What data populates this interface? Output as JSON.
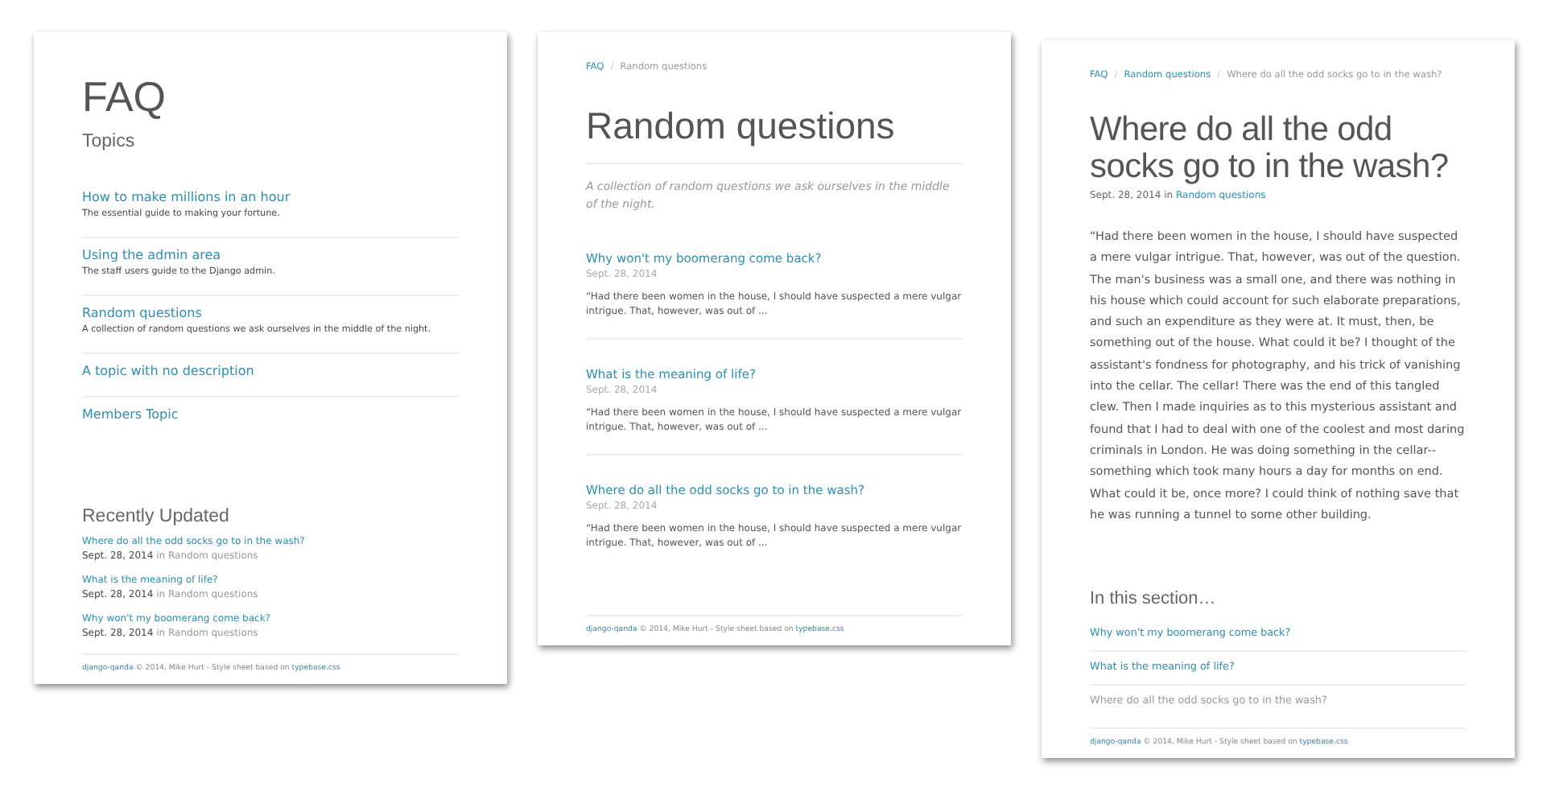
{
  "pages": [
    {
      "kind": "index",
      "title": "FAQ",
      "subtitle": "Topics",
      "topics": [
        {
          "title": "How to make millions in an hour",
          "description": "The essential guide to making your fortune."
        },
        {
          "title": "Using the admin area",
          "description": "The staff users guide to the Django admin."
        },
        {
          "title": "Random questions",
          "description": "A collection of random questions we ask ourselves in the middle of the night."
        },
        {
          "title": "A topic with no description"
        },
        {
          "title": "Members Topic"
        }
      ],
      "recent_heading": "Recently Updated",
      "recent": [
        {
          "title": "Where do all the odd socks go to in the wash?",
          "date": "Sept. 28, 2014",
          "in_label": "in",
          "category": "Random questions"
        },
        {
          "title": "What is the meaning of life?",
          "date": "Sept. 28, 2014",
          "in_label": "in",
          "category": "Random questions"
        },
        {
          "title": "Why won't my boomerang come back?",
          "date": "Sept. 28, 2014",
          "in_label": "in",
          "category": "Random questions"
        }
      ],
      "footer": {
        "project": "django-qanda",
        "text": "© 2014, Mike Hurt - Style sheet based on",
        "stylesheet": "typebase.css"
      }
    },
    {
      "kind": "topic",
      "breadcrumb": [
        {
          "label": "FAQ",
          "current": false
        },
        {
          "label": "Random questions",
          "current": true
        }
      ],
      "separator": "/",
      "title": "Random questions",
      "description": "A collection of random questions we ask ourselves in the middle of the night.",
      "questions": [
        {
          "title": "Why won't my boomerang come back?",
          "date": "Sept. 28, 2014",
          "excerpt": "“Had there been women in the house, I should have suspected a mere vulgar intrigue. That, however, was out of ..."
        },
        {
          "title": "What is the meaning of life?",
          "date": "Sept. 28, 2014",
          "excerpt": "“Had there been women in the house, I should have suspected a mere vulgar intrigue. That, however, was out of ..."
        },
        {
          "title": "Where do all the odd socks go to in the wash?",
          "date": "Sept. 28, 2014",
          "excerpt": "“Had there been women in the house, I should have suspected a mere vulgar intrigue. That, however, was out of ..."
        }
      ],
      "footer": {
        "project": "django-qanda",
        "text": "© 2014, Mike Hurt - Style sheet based on",
        "stylesheet": "typebase.css"
      }
    },
    {
      "kind": "question",
      "breadcrumb": [
        {
          "label": "FAQ",
          "current": false
        },
        {
          "label": "Random questions",
          "current": false
        },
        {
          "label": "Where do all the odd socks go to in the wash?",
          "current": true
        }
      ],
      "separator": "/",
      "title": "Where do all the odd socks go to in the wash?",
      "date": "Sept. 28, 2014",
      "in_label": "in",
      "category": "Random questions",
      "body": "“Had there been women in the house, I should have suspected a mere vulgar intrigue. That, however, was out of the question. The man's business was a small one, and there was nothing in his house which could account for such elaborate preparations, and such an expenditure as they were at. It must, then, be something out of the house. What could it be? I thought of the assistant's fondness for photography, and his trick of vanishing into the cellar. The cellar! There was the end of this tangled clew. Then I made inquiries as to this mysterious assistant and found that I had to deal with one of the coolest and most daring criminals in London. He was doing something in the cellar--something which took many hours a day for months on end. What could it be, once more? I could think of nothing save that he was running a tunnel to some other building.",
      "section_heading": "In this section…",
      "section_items": [
        {
          "title": "Why won't my boomerang come back?",
          "current": false
        },
        {
          "title": "What is the meaning of life?",
          "current": false
        },
        {
          "title": "Where do all the odd socks go to in the wash?",
          "current": true
        }
      ],
      "footer": {
        "project": "django-qanda",
        "text": "© 2014, Mike Hurt - Style sheet based on",
        "stylesheet": "typebase.css"
      }
    }
  ]
}
